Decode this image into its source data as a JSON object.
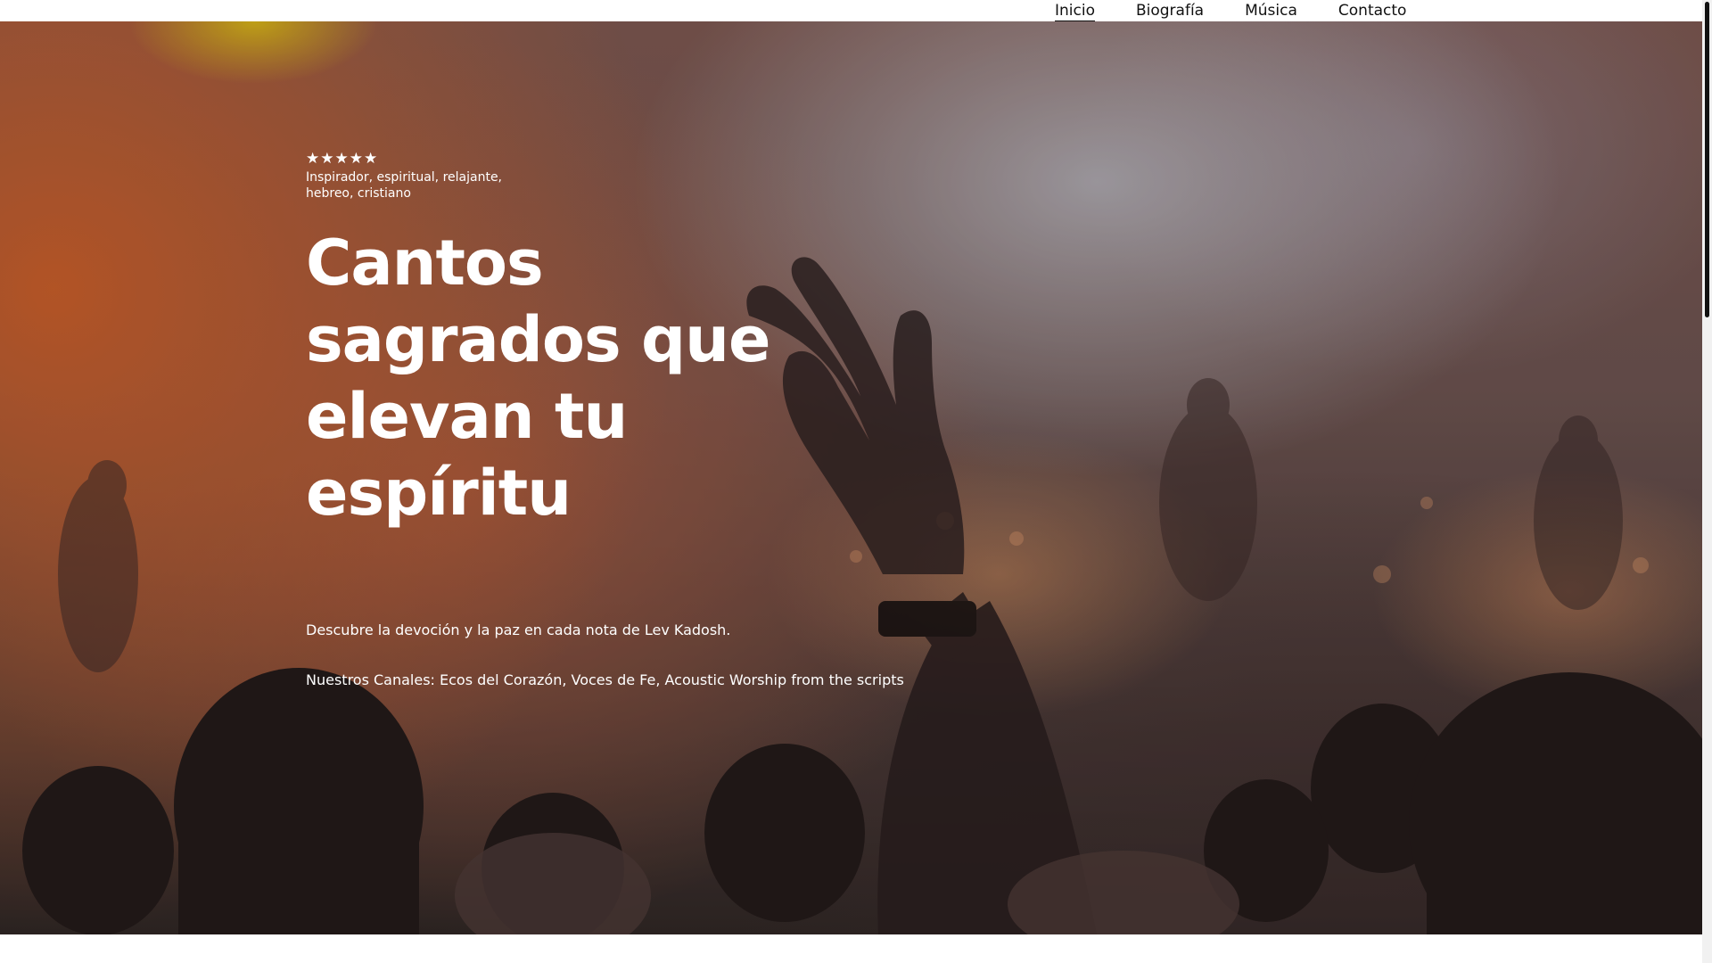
{
  "nav": {
    "items": [
      {
        "label": "Inicio",
        "active": true
      },
      {
        "label": "Biografía",
        "active": false
      },
      {
        "label": "Música",
        "active": false
      },
      {
        "label": "Contacto",
        "active": false
      }
    ]
  },
  "hero": {
    "rating_stars": "★★★★★",
    "rating": 5,
    "tags": "Inspirador, espiritual, relajante, hebreo, cristiano",
    "headline": "Cantos sagrados que elevan tu espíritu",
    "description": "Descubre la devoción y la paz en cada nota de Lev Kadosh.",
    "channels": "Nuestros Canales: Ecos del Corazón, Voces de Fe, Acoustic Worship from the scripts"
  },
  "colors": {
    "text_on_hero": "#ffffff",
    "nav_text": "#111111",
    "background": "#ffffff"
  }
}
